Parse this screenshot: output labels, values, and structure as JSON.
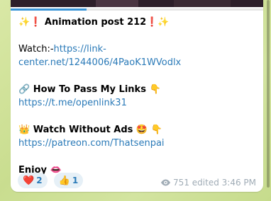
{
  "message": {
    "title_prefix": "✨❗",
    "title": "Animation post 212",
    "title_suffix": "❗✨",
    "watch_label": "Watch:-",
    "watch_link_line1": "https://link-",
    "watch_link_line2": "center.net/1244006/4PaoK1WVodlx",
    "pass_links_icon": "🔗",
    "pass_links_title": "How To Pass My Links",
    "pass_links_pointer": "👇",
    "pass_links_url": "https://t.me/openlink31",
    "noads_icon": "👑",
    "noads_title": "Watch Without Ads",
    "noads_emoji": "🤩",
    "noads_pointer": "👇",
    "noads_url": "https://patreon.com/Thatsenpai",
    "enjoy_text": "Enjoy",
    "enjoy_emoji": "👄"
  },
  "media": {
    "progress": 0.3
  },
  "reactions": [
    {
      "emoji": "❤️",
      "count": "2"
    },
    {
      "emoji": "👍",
      "count": "1"
    }
  ],
  "meta": {
    "views": "751",
    "edited": "edited 3:46 PM"
  },
  "colors": {
    "link": "#2a7ab8",
    "bubble": "#ffffff",
    "background": "#d4e5a1",
    "meta_text": "#a0acb6",
    "reaction_bg": "#e6f0f7"
  }
}
